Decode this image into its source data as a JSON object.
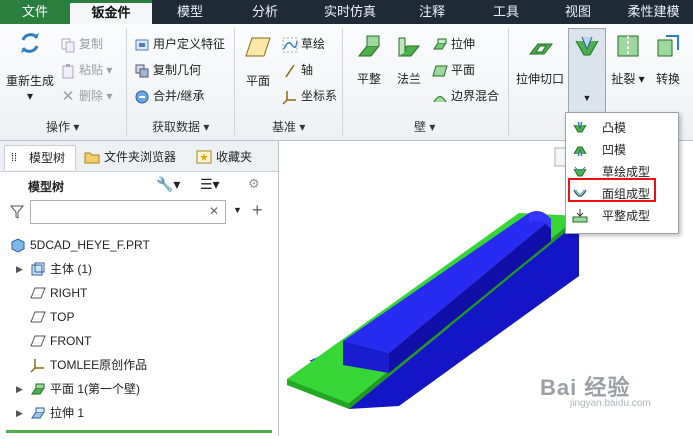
{
  "menu_tabs": [
    "文件",
    "钣金件",
    "模型",
    "分析",
    "实时仿真",
    "注释",
    "工具",
    "视图",
    "柔性建模"
  ],
  "ribbon": {
    "operations": {
      "regenerate": "重新生成",
      "copy": "复制",
      "paste": "粘贴",
      "delete": "删除",
      "group_label": "操作"
    },
    "get_data": {
      "udf": "用户定义特征",
      "copy_geometry": "复制几何",
      "merge_inherit": "合并/继承",
      "group_label": "获取数据"
    },
    "datum": {
      "plane": "平面",
      "sketch": "草绘",
      "axis": "轴",
      "csys": "坐标系",
      "group_label": "基准"
    },
    "wall": {
      "flat": "平整",
      "flange": "法兰",
      "extrude": "拉伸",
      "plane": "平面",
      "boundary_blend": "边界混合",
      "group_label": "壁"
    },
    "extrude_cut": "拉伸切口",
    "rip": "扯裂",
    "convert": "转换"
  },
  "form_dropdown": {
    "items": [
      "凸模",
      "凹模",
      "草绘成型",
      "面组成型",
      "平整成型"
    ],
    "highlighted": "面组成型"
  },
  "left_panel": {
    "tabs": [
      "模型树",
      "文件夹浏览器",
      "收藏夹"
    ],
    "tree_title": "模型树",
    "filter_placeholder": "",
    "tree_items": [
      {
        "label": "5DCAD_HEYE_F.PRT",
        "expandable": false
      },
      {
        "label": "主体 (1)",
        "expandable": true
      },
      {
        "label": "RIGHT",
        "expandable": false
      },
      {
        "label": "TOP",
        "expandable": false
      },
      {
        "label": "FRONT",
        "expandable": false
      },
      {
        "label": "TOMLEE原创作品",
        "expandable": false
      },
      {
        "label": "平面 1(第一个壁)",
        "expandable": true
      },
      {
        "label": "拉伸 1",
        "expandable": true
      }
    ]
  },
  "watermark": {
    "brand": "Bai 经验",
    "url": "jingyan.baidu.com"
  },
  "colors": {
    "accent": "#2a7f3f",
    "menubar": "#1e2a36",
    "model_blue": "#1a1adc",
    "model_green": "#2ed12e",
    "highlight": "#e11111"
  }
}
